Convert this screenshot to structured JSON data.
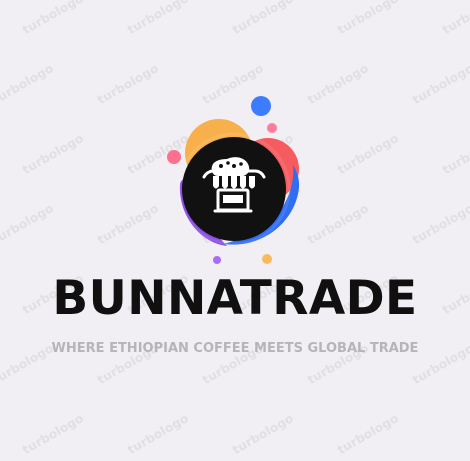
{
  "brand": {
    "name": "BUNNATRADE",
    "tagline": "WHERE ETHIOPIAN COFFEE MEETS GLOBAL TRADE"
  },
  "watermark": {
    "text": "turbologo"
  },
  "logo": {
    "icon": "market-stall-icon"
  },
  "colors": {
    "background": "#f1eff3",
    "brand_text": "#101010",
    "tagline_text": "#b5b5b8",
    "blob_orange": "#f8b04c",
    "blob_red": "#f65b5f",
    "blob_purple": "#8b4ce5",
    "blob_blue": "#2f6df3",
    "blob_pink": "#ff6f8e",
    "dot_blue": "#3d7cff",
    "dot_pink": "#ff7ca0",
    "dot_purple": "#a66cff",
    "dot_orange": "#f7ba5d",
    "circle_black": "#111111"
  }
}
